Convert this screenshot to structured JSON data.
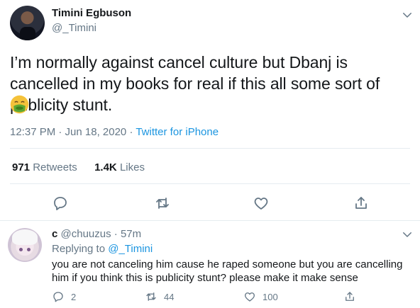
{
  "tweet": {
    "author_name": "Timini Egbuson",
    "author_handle": "@_Timini",
    "text": "I’m normally against cancel culture but Dbanj is cancelled in my books for real if this all some sort of publicity stunt.",
    "emoji": "nauseated-face-emoji",
    "time": "12:37 PM · Jun 18, 2020 · ",
    "source": "Twitter for iPhone",
    "retweets_count": "971",
    "retweets_label": "Retweets",
    "likes_count": "1.4K",
    "likes_label": "Likes"
  },
  "reply": {
    "author_name": "c",
    "author_handle": "@chuuzus",
    "time_ago": "57m",
    "replying_to_label": "Replying to",
    "replying_to_handle": "@_Timini",
    "text": "you are not canceling him cause he raped someone but you are cancelling him if you think this is publicity stunt? please make it make sense",
    "reply_count": "2",
    "retweet_count": "44",
    "like_count": "100"
  },
  "colors": {
    "text": "#14171a",
    "secondary": "#657786",
    "link": "#1b95e0",
    "divider": "#e6ecf0"
  }
}
